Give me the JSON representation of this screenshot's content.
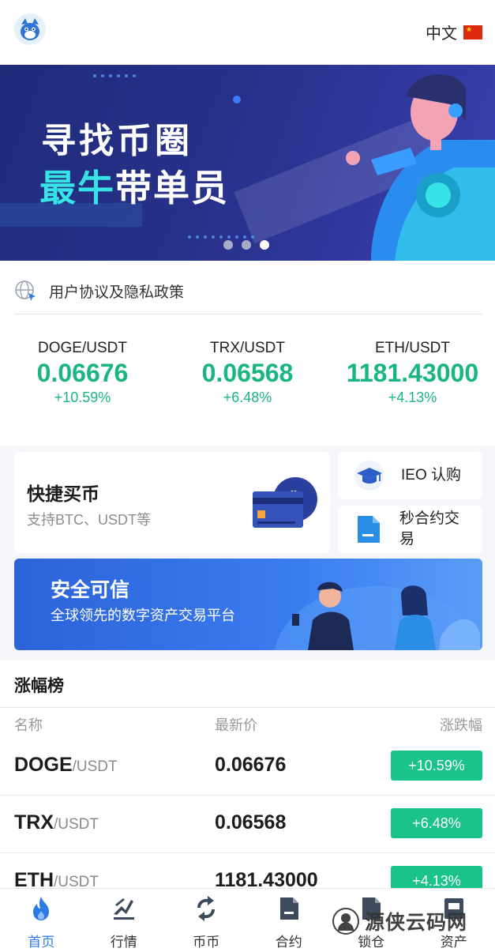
{
  "header": {
    "language_label": "中文"
  },
  "banner": {
    "line1": "寻找币圈",
    "line2_highlight": "最牛",
    "line2_rest": "带单员",
    "slide_count": 3,
    "active_slide": 3,
    "accent_color": "#37e3e6"
  },
  "notice": {
    "text": "用户协议及隐私政策"
  },
  "tickers": [
    {
      "pair": "DOGE/USDT",
      "price": "0.06676",
      "change": "+10.59%"
    },
    {
      "pair": "TRX/USDT",
      "price": "0.06568",
      "change": "+6.48%"
    },
    {
      "pair": "ETH/USDT",
      "price": "1181.43000",
      "change": "+4.13%"
    }
  ],
  "features": {
    "quick_buy": {
      "title": "快捷买币",
      "subtitle": "支持BTC、USDT等"
    },
    "ieo": {
      "label": "IEO 认购"
    },
    "second_contract": {
      "label": "秒合约交易"
    },
    "secure": {
      "title": "安全可信",
      "subtitle": "全球领先的数字资产交易平台"
    }
  },
  "ranking": {
    "title": "涨幅榜",
    "columns": {
      "name": "名称",
      "price": "最新价",
      "change": "涨跌幅"
    },
    "rows": [
      {
        "base": "DOGE",
        "quote": "/USDT",
        "price": "0.06676",
        "change": "+10.59%"
      },
      {
        "base": "TRX",
        "quote": "/USDT",
        "price": "0.06568",
        "change": "+6.48%"
      },
      {
        "base": "ETH",
        "quote": "/USDT",
        "price": "1181.43000",
        "change": "+4.13%"
      }
    ]
  },
  "tabbar": {
    "active": "首页",
    "items": [
      {
        "label": "首页",
        "icon": "flame-icon"
      },
      {
        "label": "行情",
        "icon": "market-icon"
      },
      {
        "label": "币币",
        "icon": "exchange-icon"
      },
      {
        "label": "合约",
        "icon": "contract-icon"
      },
      {
        "label": "锁仓",
        "icon": "lock-position-icon"
      },
      {
        "label": "资产",
        "icon": "assets-icon"
      }
    ]
  },
  "watermark": {
    "text": "源侠云码网"
  },
  "colors": {
    "up_green": "#19b67e",
    "badge_green": "#19c38a",
    "active_blue": "#2c7be5"
  }
}
